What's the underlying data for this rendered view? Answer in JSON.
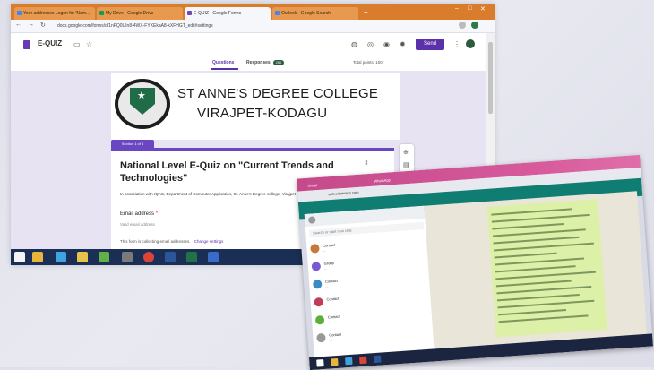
{
  "browser": {
    "tabs": [
      {
        "label": "Your addresses Logon for 'Nam...",
        "favicon_color": "#4285f4"
      },
      {
        "label": "My Drive - Google Drive",
        "favicon_color": "#0f9d58"
      },
      {
        "label": "E-QUIZ - Google Forms",
        "favicon_color": "#7248b9"
      },
      {
        "label": "Outlook - Google Search",
        "favicon_color": "#4285f4"
      }
    ],
    "new_tab": "+",
    "window_controls": [
      "–",
      "□",
      "✕"
    ],
    "url": "docs.google.com/forms/d/1nFQ0UIn8-4WX-FYXEkaA8-kXFHGT_edit#settings",
    "nav_icons": {
      "back": "←",
      "forward": "→",
      "reload": "↻"
    }
  },
  "forms": {
    "title": "E-QUIZ",
    "send_label": "Send",
    "toolbar_icons": [
      "palette-icon",
      "preview-icon",
      "eye-icon",
      "settings-icon"
    ],
    "tabs": {
      "questions": "Questions",
      "responses": "Responses",
      "responses_count": "250"
    },
    "total_points": "Total points: 100"
  },
  "header": {
    "college_line1": "ST ANNE'S DEGREE COLLEGE",
    "college_line2": "VIRAJPET-KODAGU"
  },
  "section": {
    "tag": "Section 1 of 3"
  },
  "card": {
    "title": "National Level E-Quiz on \"Current Trends and Technologies\"",
    "description": "In association with IQAC, Department of Computer Application, St. Anne's Degree college, Virajpet",
    "email_label": "Email address",
    "email_required": "*",
    "email_placeholder": "Valid email address",
    "collecting_note": "This form is collecting email addresses.",
    "change_settings": "Change settings"
  },
  "side_tools": [
    "add-question-icon",
    "import-icon",
    "title-icon",
    "image-icon",
    "video-icon",
    "section-icon"
  ],
  "taskbar_icons": [
    {
      "name": "start-icon",
      "color": "#f4f4f4"
    },
    {
      "name": "file-explorer-icon",
      "color": "#e7b53a"
    },
    {
      "name": "ie-icon",
      "color": "#3fa3e0"
    },
    {
      "name": "folder-icon",
      "color": "#e7c34a"
    },
    {
      "name": "media-icon",
      "color": "#63b04a"
    },
    {
      "name": "app-icon",
      "color": "#7a7a7a"
    },
    {
      "name": "chrome-icon",
      "color": "#db4437"
    },
    {
      "name": "word-icon",
      "color": "#2b579a"
    },
    {
      "name": "excel-icon",
      "color": "#217346"
    },
    {
      "name": "game-icon",
      "color": "#3a6bc9"
    }
  ],
  "inset": {
    "tabs": [
      "Gmail",
      "WhatsApp"
    ],
    "url": "web.whatsapp.com",
    "search_placeholder": "Search or start new chat",
    "chats": [
      {
        "name": "Contact",
        "msg": "...",
        "color": "#c47a3a"
      },
      {
        "name": "Group",
        "msg": "...",
        "color": "#7a5ad0"
      },
      {
        "name": "Contact",
        "msg": "...",
        "color": "#3a8ac4"
      },
      {
        "name": "Contact",
        "msg": "...",
        "color": "#c43a5a"
      },
      {
        "name": "Contact",
        "msg": "...",
        "color": "#5ab03a"
      },
      {
        "name": "Contact",
        "msg": "...",
        "color": "#999999"
      }
    ]
  }
}
